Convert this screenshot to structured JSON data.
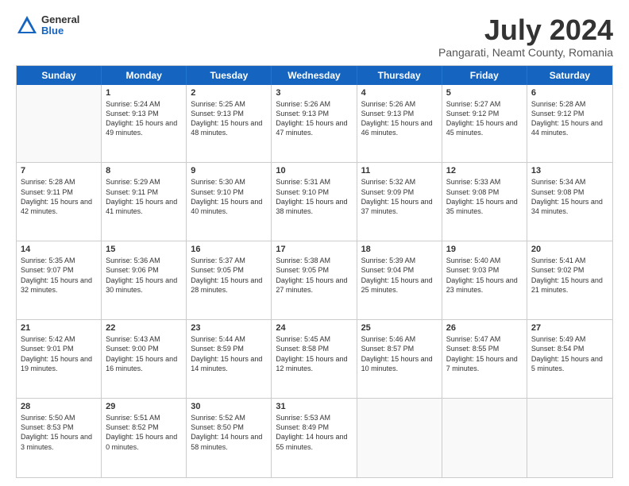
{
  "header": {
    "logo": {
      "line1": "General",
      "line2": "Blue"
    },
    "title": "July 2024",
    "subtitle": "Pangarati, Neamt County, Romania"
  },
  "weekdays": [
    "Sunday",
    "Monday",
    "Tuesday",
    "Wednesday",
    "Thursday",
    "Friday",
    "Saturday"
  ],
  "weeks": [
    [
      {
        "day": null,
        "info": null
      },
      {
        "day": "1",
        "info": "Sunrise: 5:24 AM\nSunset: 9:13 PM\nDaylight: 15 hours\nand 49 minutes."
      },
      {
        "day": "2",
        "info": "Sunrise: 5:25 AM\nSunset: 9:13 PM\nDaylight: 15 hours\nand 48 minutes."
      },
      {
        "day": "3",
        "info": "Sunrise: 5:26 AM\nSunset: 9:13 PM\nDaylight: 15 hours\nand 47 minutes."
      },
      {
        "day": "4",
        "info": "Sunrise: 5:26 AM\nSunset: 9:13 PM\nDaylight: 15 hours\nand 46 minutes."
      },
      {
        "day": "5",
        "info": "Sunrise: 5:27 AM\nSunset: 9:12 PM\nDaylight: 15 hours\nand 45 minutes."
      },
      {
        "day": "6",
        "info": "Sunrise: 5:28 AM\nSunset: 9:12 PM\nDaylight: 15 hours\nand 44 minutes."
      }
    ],
    [
      {
        "day": "7",
        "info": "Sunrise: 5:28 AM\nSunset: 9:11 PM\nDaylight: 15 hours\nand 42 minutes."
      },
      {
        "day": "8",
        "info": "Sunrise: 5:29 AM\nSunset: 9:11 PM\nDaylight: 15 hours\nand 41 minutes."
      },
      {
        "day": "9",
        "info": "Sunrise: 5:30 AM\nSunset: 9:10 PM\nDaylight: 15 hours\nand 40 minutes."
      },
      {
        "day": "10",
        "info": "Sunrise: 5:31 AM\nSunset: 9:10 PM\nDaylight: 15 hours\nand 38 minutes."
      },
      {
        "day": "11",
        "info": "Sunrise: 5:32 AM\nSunset: 9:09 PM\nDaylight: 15 hours\nand 37 minutes."
      },
      {
        "day": "12",
        "info": "Sunrise: 5:33 AM\nSunset: 9:08 PM\nDaylight: 15 hours\nand 35 minutes."
      },
      {
        "day": "13",
        "info": "Sunrise: 5:34 AM\nSunset: 9:08 PM\nDaylight: 15 hours\nand 34 minutes."
      }
    ],
    [
      {
        "day": "14",
        "info": "Sunrise: 5:35 AM\nSunset: 9:07 PM\nDaylight: 15 hours\nand 32 minutes."
      },
      {
        "day": "15",
        "info": "Sunrise: 5:36 AM\nSunset: 9:06 PM\nDaylight: 15 hours\nand 30 minutes."
      },
      {
        "day": "16",
        "info": "Sunrise: 5:37 AM\nSunset: 9:05 PM\nDaylight: 15 hours\nand 28 minutes."
      },
      {
        "day": "17",
        "info": "Sunrise: 5:38 AM\nSunset: 9:05 PM\nDaylight: 15 hours\nand 27 minutes."
      },
      {
        "day": "18",
        "info": "Sunrise: 5:39 AM\nSunset: 9:04 PM\nDaylight: 15 hours\nand 25 minutes."
      },
      {
        "day": "19",
        "info": "Sunrise: 5:40 AM\nSunset: 9:03 PM\nDaylight: 15 hours\nand 23 minutes."
      },
      {
        "day": "20",
        "info": "Sunrise: 5:41 AM\nSunset: 9:02 PM\nDaylight: 15 hours\nand 21 minutes."
      }
    ],
    [
      {
        "day": "21",
        "info": "Sunrise: 5:42 AM\nSunset: 9:01 PM\nDaylight: 15 hours\nand 19 minutes."
      },
      {
        "day": "22",
        "info": "Sunrise: 5:43 AM\nSunset: 9:00 PM\nDaylight: 15 hours\nand 16 minutes."
      },
      {
        "day": "23",
        "info": "Sunrise: 5:44 AM\nSunset: 8:59 PM\nDaylight: 15 hours\nand 14 minutes."
      },
      {
        "day": "24",
        "info": "Sunrise: 5:45 AM\nSunset: 8:58 PM\nDaylight: 15 hours\nand 12 minutes."
      },
      {
        "day": "25",
        "info": "Sunrise: 5:46 AM\nSunset: 8:57 PM\nDaylight: 15 hours\nand 10 minutes."
      },
      {
        "day": "26",
        "info": "Sunrise: 5:47 AM\nSunset: 8:55 PM\nDaylight: 15 hours\nand 7 minutes."
      },
      {
        "day": "27",
        "info": "Sunrise: 5:49 AM\nSunset: 8:54 PM\nDaylight: 15 hours\nand 5 minutes."
      }
    ],
    [
      {
        "day": "28",
        "info": "Sunrise: 5:50 AM\nSunset: 8:53 PM\nDaylight: 15 hours\nand 3 minutes."
      },
      {
        "day": "29",
        "info": "Sunrise: 5:51 AM\nSunset: 8:52 PM\nDaylight: 15 hours\nand 0 minutes."
      },
      {
        "day": "30",
        "info": "Sunrise: 5:52 AM\nSunset: 8:50 PM\nDaylight: 14 hours\nand 58 minutes."
      },
      {
        "day": "31",
        "info": "Sunrise: 5:53 AM\nSunset: 8:49 PM\nDaylight: 14 hours\nand 55 minutes."
      },
      {
        "day": null,
        "info": null
      },
      {
        "day": null,
        "info": null
      },
      {
        "day": null,
        "info": null
      }
    ]
  ]
}
